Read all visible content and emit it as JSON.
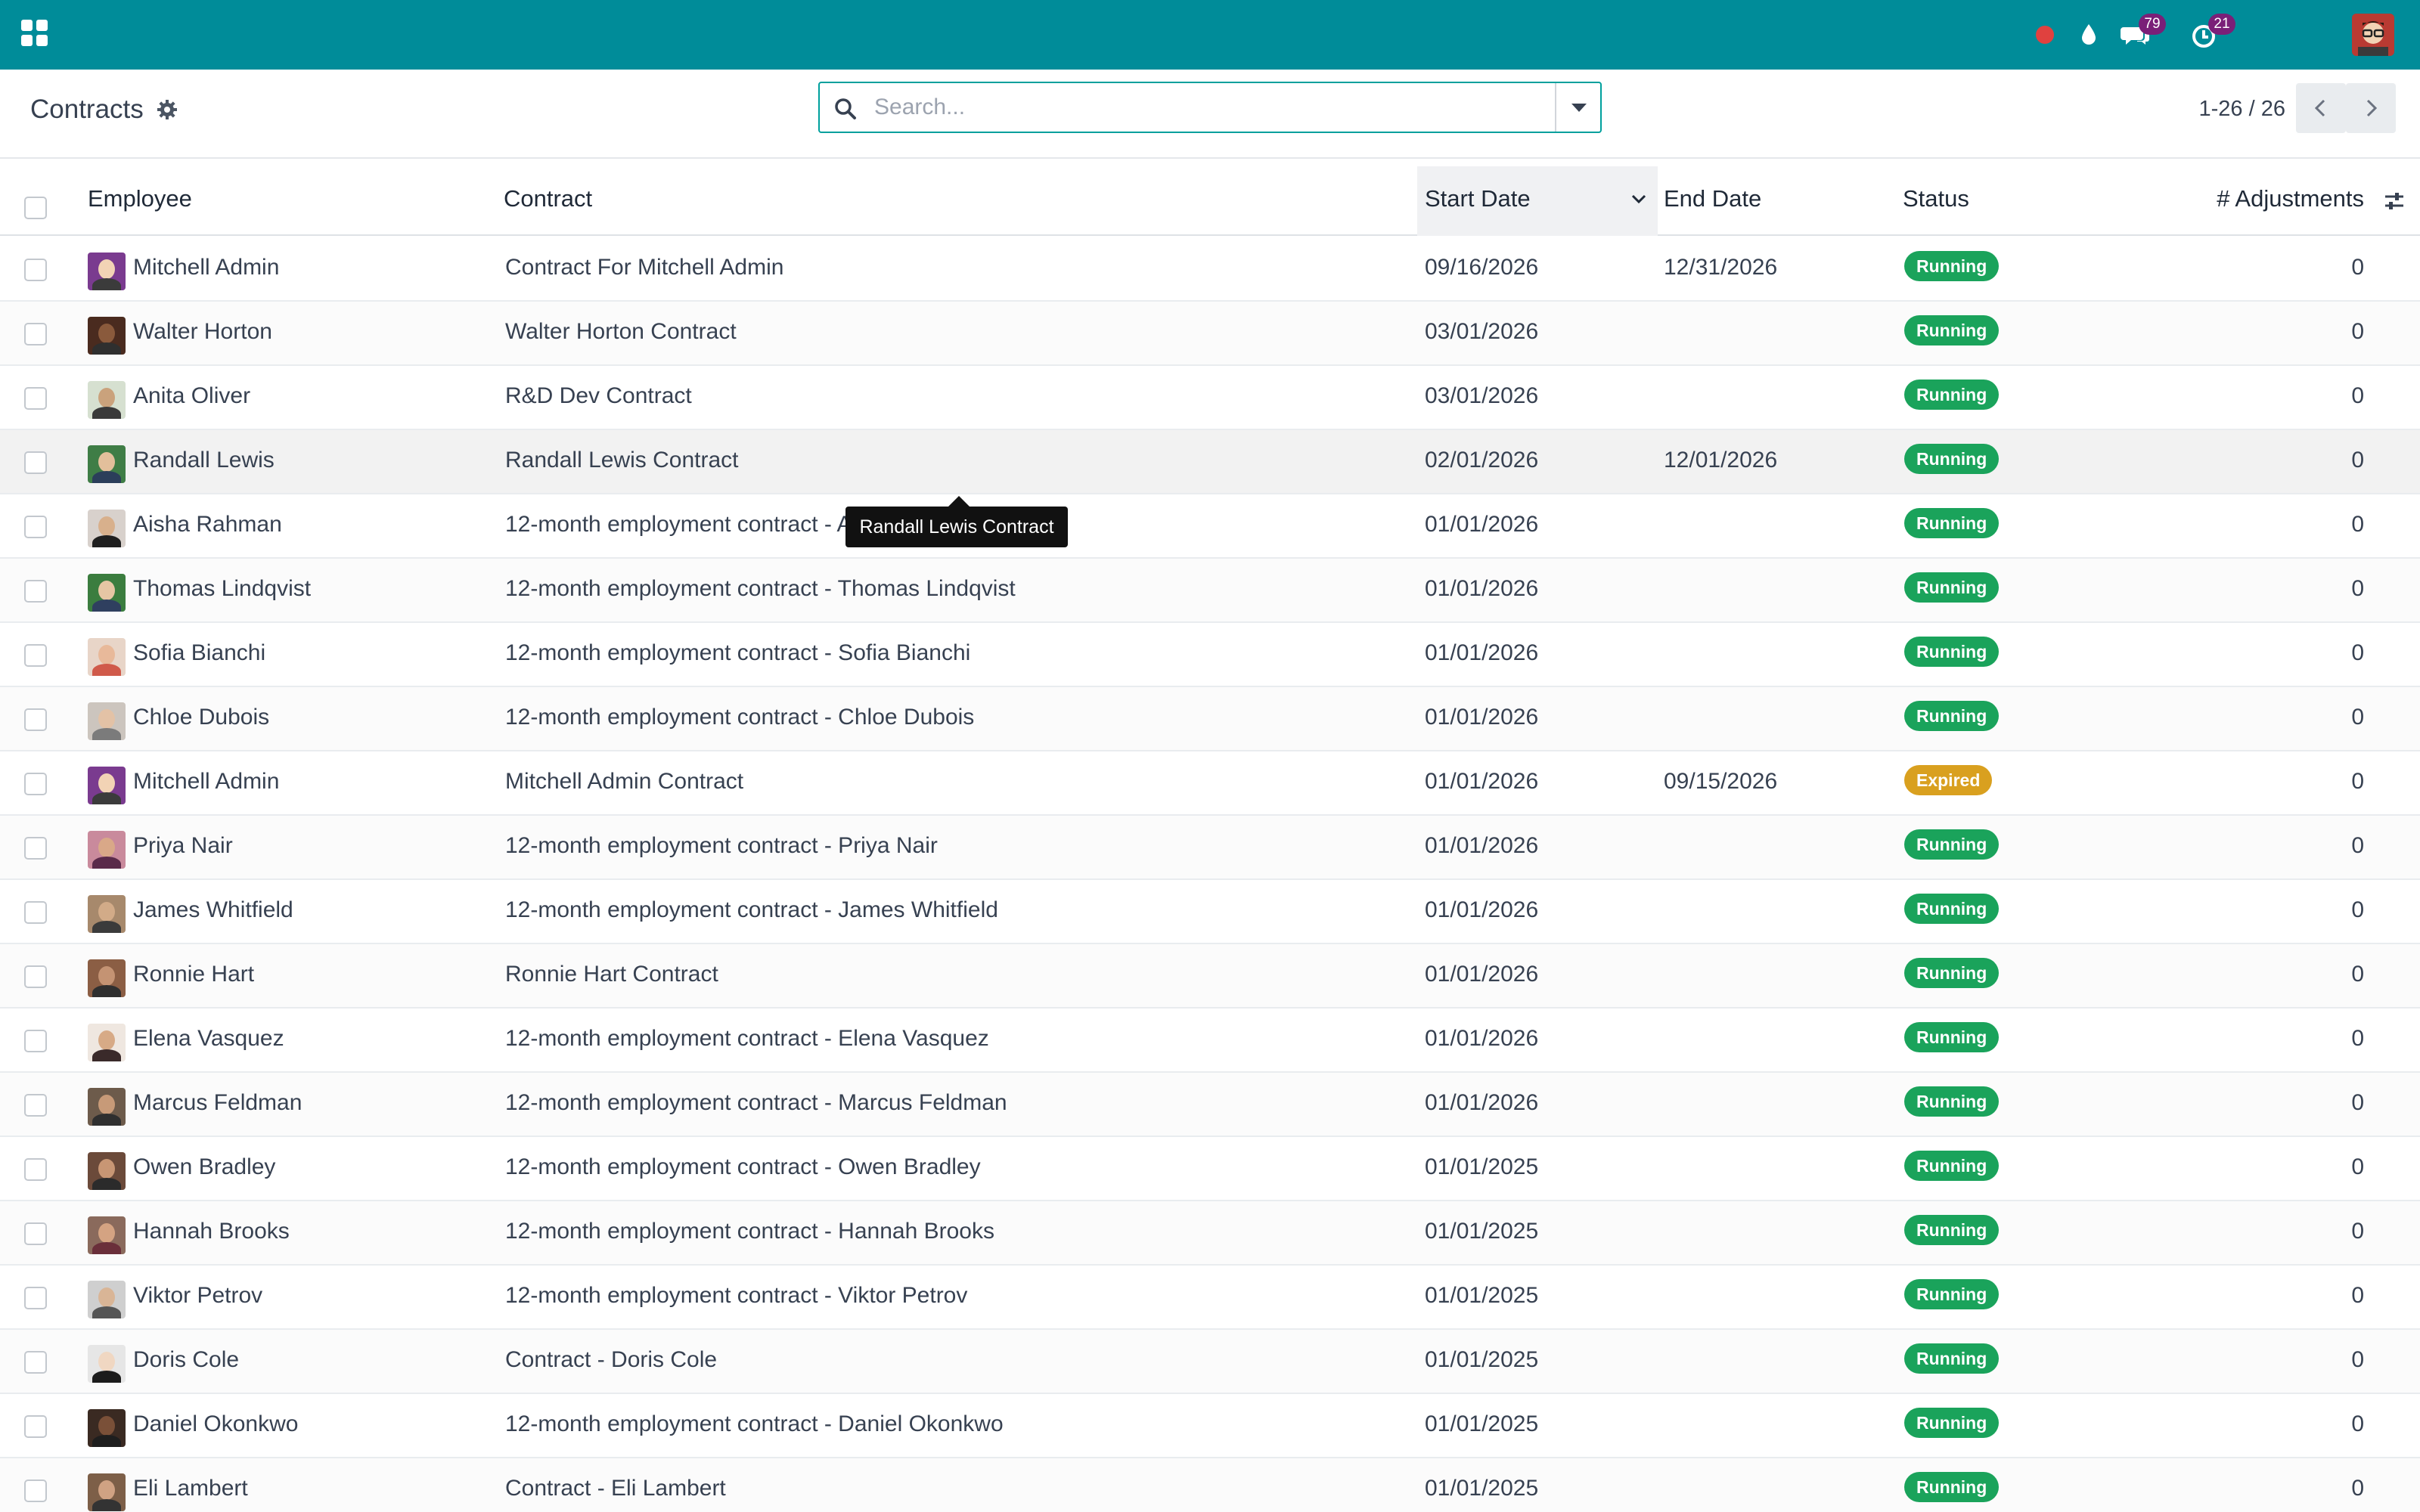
{
  "navbar": {
    "apps_icon": "apps-grid-icon",
    "recording_icon": "red-dot-icon",
    "drop_icon": "drop-icon",
    "messages_icon": "chat-bubbles-icon",
    "messages_count": "79",
    "activities_icon": "clock-icon",
    "activities_count": "21",
    "user_avatar": "user-avatar"
  },
  "control_panel": {
    "title": "Contracts",
    "search_placeholder": "Search...",
    "pager_text": "1-26 / 26"
  },
  "table": {
    "columns": {
      "employee": "Employee",
      "contract": "Contract",
      "start_date": "Start Date",
      "end_date": "End Date",
      "status": "Status",
      "adjustments": "# Adjustments"
    },
    "rows": [
      {
        "employee": "Mitchell Admin",
        "contract": "Contract For Mitchell Admin",
        "start": "09/16/2026",
        "end": "12/31/2026",
        "status": "Running",
        "adjustments": "0"
      },
      {
        "employee": "Walter Horton",
        "contract": "Walter Horton Contract",
        "start": "03/01/2026",
        "end": "",
        "status": "Running",
        "adjustments": "0"
      },
      {
        "employee": "Anita Oliver",
        "contract": "R&D Dev Contract",
        "start": "03/01/2026",
        "end": "",
        "status": "Running",
        "adjustments": "0"
      },
      {
        "employee": "Randall Lewis",
        "contract": "Randall Lewis Contract",
        "start": "02/01/2026",
        "end": "12/01/2026",
        "status": "Running",
        "adjustments": "0"
      },
      {
        "employee": "Aisha Rahman",
        "contract": "12-month employment contract - Aisha Rahman",
        "start": "01/01/2026",
        "end": "",
        "status": "Running",
        "adjustments": "0"
      },
      {
        "employee": "Thomas Lindqvist",
        "contract": "12-month employment contract - Thomas Lindqvist",
        "start": "01/01/2026",
        "end": "",
        "status": "Running",
        "adjustments": "0"
      },
      {
        "employee": "Sofia Bianchi",
        "contract": "12-month employment contract - Sofia Bianchi",
        "start": "01/01/2026",
        "end": "",
        "status": "Running",
        "adjustments": "0"
      },
      {
        "employee": "Chloe Dubois",
        "contract": "12-month employment contract - Chloe Dubois",
        "start": "01/01/2026",
        "end": "",
        "status": "Running",
        "adjustments": "0"
      },
      {
        "employee": "Mitchell Admin",
        "contract": "Mitchell Admin Contract",
        "start": "01/01/2026",
        "end": "09/15/2026",
        "status": "Expired",
        "adjustments": "0"
      },
      {
        "employee": "Priya Nair",
        "contract": "12-month employment contract - Priya Nair",
        "start": "01/01/2026",
        "end": "",
        "status": "Running",
        "adjustments": "0"
      },
      {
        "employee": "James Whitfield",
        "contract": "12-month employment contract - James Whitfield",
        "start": "01/01/2026",
        "end": "",
        "status": "Running",
        "adjustments": "0"
      },
      {
        "employee": "Ronnie Hart",
        "contract": "Ronnie Hart Contract",
        "start": "01/01/2026",
        "end": "",
        "status": "Running",
        "adjustments": "0"
      },
      {
        "employee": "Elena Vasquez",
        "contract": "12-month employment contract - Elena Vasquez",
        "start": "01/01/2026",
        "end": "",
        "status": "Running",
        "adjustments": "0"
      },
      {
        "employee": "Marcus Feldman",
        "contract": "12-month employment contract - Marcus Feldman",
        "start": "01/01/2026",
        "end": "",
        "status": "Running",
        "adjustments": "0"
      },
      {
        "employee": "Owen Bradley",
        "contract": "12-month employment contract - Owen Bradley",
        "start": "01/01/2025",
        "end": "",
        "status": "Running",
        "adjustments": "0"
      },
      {
        "employee": "Hannah Brooks",
        "contract": "12-month employment contract - Hannah Brooks",
        "start": "01/01/2025",
        "end": "",
        "status": "Running",
        "adjustments": "0"
      },
      {
        "employee": "Viktor Petrov",
        "contract": "12-month employment contract - Viktor Petrov",
        "start": "01/01/2025",
        "end": "",
        "status": "Running",
        "adjustments": "0"
      },
      {
        "employee": "Doris Cole",
        "contract": "Contract - Doris Cole",
        "start": "01/01/2025",
        "end": "",
        "status": "Running",
        "adjustments": "0"
      },
      {
        "employee": "Daniel Okonkwo",
        "contract": "12-month employment contract - Daniel Okonkwo",
        "start": "01/01/2025",
        "end": "",
        "status": "Running",
        "adjustments": "0"
      },
      {
        "employee": "Eli Lambert",
        "contract": "Contract - Eli Lambert",
        "start": "01/01/2025",
        "end": "",
        "status": "Running",
        "adjustments": "0"
      }
    ]
  },
  "tooltip": {
    "text": "Randall Lewis Contract"
  },
  "colors": {
    "navbar": "#008c99",
    "running": "#1aa35b",
    "expired": "#d9a01f",
    "badge": "#7a1f78"
  }
}
